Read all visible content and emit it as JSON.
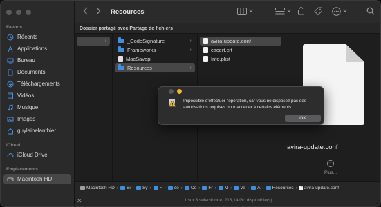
{
  "toolbar": {
    "title": "Resources"
  },
  "path_header": "Dossier partagé avec Partage de fichiers",
  "sidebar": {
    "favorites_header": "Favoris",
    "favorites": [
      {
        "label": "Récents",
        "icon": "clock-icon"
      },
      {
        "label": "Applications",
        "icon": "applications-icon"
      },
      {
        "label": "Bureau",
        "icon": "desktop-icon"
      },
      {
        "label": "Documents",
        "icon": "document-icon"
      },
      {
        "label": "Téléchargements",
        "icon": "download-icon"
      },
      {
        "label": "Vidéos",
        "icon": "film-icon"
      },
      {
        "label": "Musique",
        "icon": "music-icon"
      },
      {
        "label": "Images",
        "icon": "photo-icon"
      },
      {
        "label": "guylainelanthier",
        "icon": "home-icon"
      }
    ],
    "icloud_header": "iCloud",
    "icloud": [
      {
        "label": "iCloud Drive",
        "icon": "cloud-icon"
      }
    ],
    "locations_header": "Emplacements",
    "locations": [
      {
        "label": "Macintosh HD",
        "icon": "disk-icon"
      }
    ]
  },
  "columns": {
    "col2": [
      {
        "label": "_CodeSignature",
        "kind": "folder"
      },
      {
        "label": "Frameworks",
        "kind": "folder"
      },
      {
        "label": "MacSavapi",
        "kind": "file"
      },
      {
        "label": "Resources",
        "kind": "folder"
      }
    ],
    "col3": [
      {
        "label": "avira-update.conf",
        "kind": "file"
      },
      {
        "label": "cacert.crt",
        "kind": "file"
      },
      {
        "label": "Info.plist",
        "kind": "file"
      }
    ]
  },
  "preview": {
    "filename": "avira-update.conf",
    "more_label": "Plus..."
  },
  "pathbar": {
    "items": [
      "Macintosh HD",
      "Bi",
      "Sy",
      "F",
      "co",
      "Co",
      "Fr",
      "M",
      "Ve",
      "A",
      "Resources",
      "avira-update.conf"
    ]
  },
  "status": "1 sur 3 sélectionné, 213,14 Go disponible(s)",
  "dialog": {
    "message": "Impossible d'effectuer l'opération, car vous ne disposez pas des autorisations requises pour accéder à certains éléments.",
    "ok_label": "OK"
  },
  "colors": {
    "accent": "#3f8ee0",
    "dialog_yellow": "#f3b72e"
  }
}
